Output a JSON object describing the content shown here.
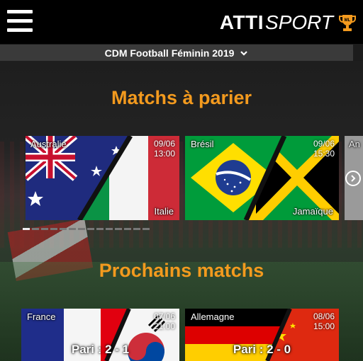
{
  "header": {
    "logo_bold": "ATTI",
    "logo_italic": "SPORT",
    "trophy_text": "ML"
  },
  "competition_selector": {
    "label": "CDM Football Féminin 2019"
  },
  "sections": {
    "bet_title": "Matchs à parier",
    "upcoming_title": "Prochains matchs"
  },
  "bet_matches": [
    {
      "home": "Australie",
      "away": "Italie",
      "date": "09/06",
      "time": "13:00"
    },
    {
      "home": "Brésil",
      "away": "Jamaïque",
      "date": "09/06",
      "time": "15:30"
    },
    {
      "home": "An"
    }
  ],
  "upcoming_matches": [
    {
      "home": "France",
      "date": "07/06",
      "time": "21:00",
      "bet": "Pari : 2 - 1"
    },
    {
      "home": "Allemagne",
      "date": "08/06",
      "time": "15:00",
      "bet": "Pari : 2 - 0"
    }
  ],
  "carousel": {
    "pages": 14,
    "active": 0
  },
  "colors": {
    "accent": "#f39a1e",
    "topbar": "#000000",
    "selector": "#3a3a3a"
  }
}
